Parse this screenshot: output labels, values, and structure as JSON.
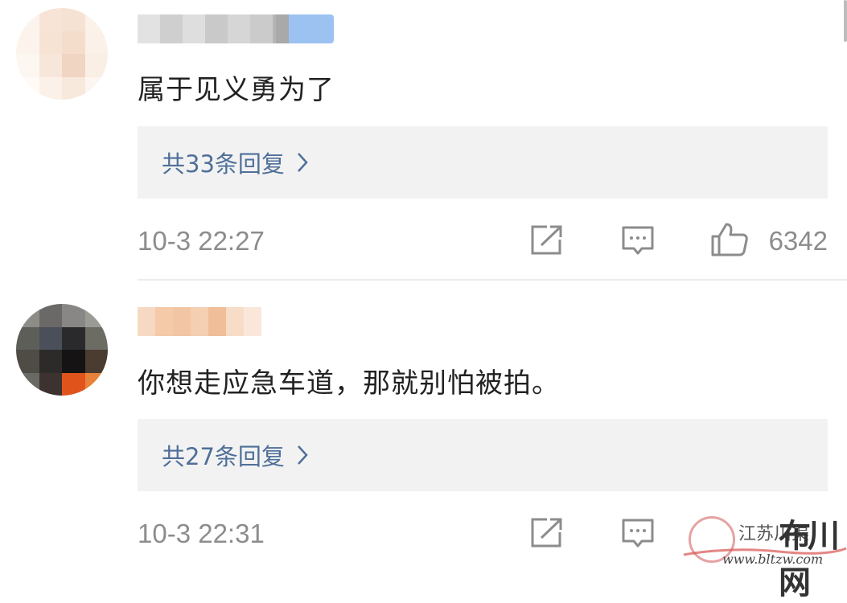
{
  "comments": [
    {
      "text": "属于见义勇为了",
      "replies_label": "共33条回复",
      "timestamp": "10-3 22:27",
      "likes": "6342"
    },
    {
      "text": "你想走应急车道，那就别怕被拍。",
      "replies_label": "共27条回复",
      "timestamp": "10-3 22:31",
      "likes": ""
    }
  ],
  "icons": {
    "share": "share-icon",
    "comment": "comment-icon",
    "like": "thumbs-up-icon",
    "chevron": "chevron-right-icon"
  },
  "colors": {
    "reply_link": "#4f6f99",
    "meta_gray": "#8c8c8c",
    "reply_bg": "#f2f2f2"
  },
  "watermark": {
    "name": "布川网",
    "sub": "江苏川渠",
    "url": "www.bltzw.com"
  }
}
